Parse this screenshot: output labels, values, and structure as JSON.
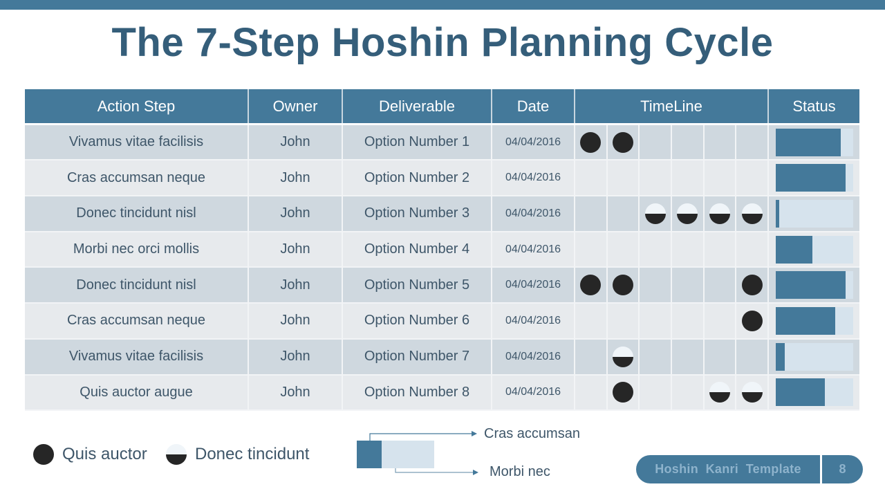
{
  "title": "The 7-Step Hoshin Planning Cycle",
  "table": {
    "headers": {
      "action_step": "Action Step",
      "owner": "Owner",
      "deliverable": "Deliverable",
      "date": "Date",
      "timeline": "TimeLine",
      "status": "Status"
    },
    "rows": [
      {
        "action_step": "Vivamus vitae facilisis",
        "owner": "John",
        "deliverable": "Option Number 1",
        "date": "04/04/2016",
        "timeline": [
          "full",
          "full",
          "",
          "",
          "",
          ""
        ],
        "status_percent": 84
      },
      {
        "action_step": "Cras accumsan  neque",
        "owner": "John",
        "deliverable": "Option Number 2",
        "date": "04/04/2016",
        "timeline": [
          "",
          "",
          "",
          "",
          "",
          ""
        ],
        "status_percent": 91
      },
      {
        "action_step": "Donec tincidunt  nisl",
        "owner": "John",
        "deliverable": "Option Number 3",
        "date": "04/04/2016",
        "timeline": [
          "",
          "",
          "half",
          "half",
          "half",
          "half"
        ],
        "status_percent": 5
      },
      {
        "action_step": "Morbi nec orci mollis",
        "owner": "John",
        "deliverable": "Option Number 4",
        "date": "04/04/2016",
        "timeline": [
          "",
          "",
          "",
          "",
          "",
          ""
        ],
        "status_percent": 48
      },
      {
        "action_step": "Donec tincidunt  nisl",
        "owner": "John",
        "deliverable": "Option Number 5",
        "date": "04/04/2016",
        "timeline": [
          "full",
          "full",
          "",
          "",
          "",
          "full"
        ],
        "status_percent": 91
      },
      {
        "action_step": "Cras accumsan  neque",
        "owner": "John",
        "deliverable": "Option Number 6",
        "date": "04/04/2016",
        "timeline": [
          "",
          "",
          "",
          "",
          "",
          "full"
        ],
        "status_percent": 77
      },
      {
        "action_step": "Vivamus vitae facilisis",
        "owner": "John",
        "deliverable": "Option Number 7",
        "date": "04/04/2016",
        "timeline": [
          "",
          "half",
          "",
          "",
          "",
          ""
        ],
        "status_percent": 12
      },
      {
        "action_step": "Quis auctor augue",
        "owner": "John",
        "deliverable": "Option Number 8",
        "date": "04/04/2016",
        "timeline": [
          "",
          "full",
          "",
          "",
          "half",
          "half"
        ],
        "status_percent": 64
      }
    ]
  },
  "legend": {
    "full_label": "Quis auctor",
    "half_label": "Donec tincidunt",
    "status_key_filled_label": "Cras accumsan",
    "status_key_remaining_label": "Morbi nec"
  },
  "footer": {
    "template_name": "Hoshin  Kanri  Template",
    "page_number": "8"
  },
  "colors": {
    "accent": "#44799a",
    "title": "#355e7a",
    "row_odd": "#cfd8df",
    "row_even": "#e7eaed",
    "status_track": "#d6e3ed",
    "marker": "#262626"
  }
}
